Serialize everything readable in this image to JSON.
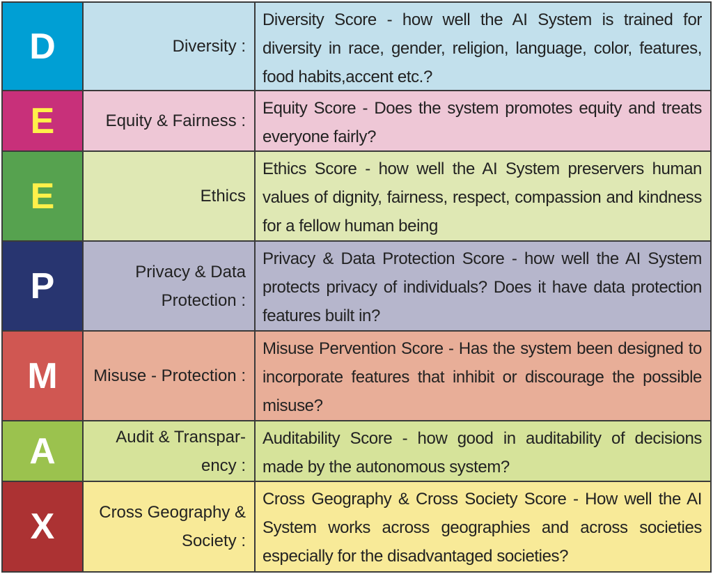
{
  "rows": [
    {
      "letter": "D",
      "label": "Diversity :",
      "description": "Diversity Score - how well the AI System is  trained for diversity in race, gender, religion, language, color, features, food habits,accent etc.?",
      "letter_color": "#ffffff",
      "letter_bg": "#009fd4",
      "row_bg": "#c2e0ec"
    },
    {
      "letter": "E",
      "label": "Equity & Fairness :",
      "description": "Equity Score - Does the system promotes equity and treats everyone fairly?",
      "letter_color": "#fff04a",
      "letter_bg": "#c8307a",
      "row_bg": "#eec7d6"
    },
    {
      "letter": "E",
      "label": "Ethics",
      "description": "Ethics Score - how well the AI System preservers human values of dignity, fairness, respect, compassion and kindness for a fellow human being",
      "letter_color": "#fff04a",
      "letter_bg": "#56a24f",
      "row_bg": "#dfe8b4"
    },
    {
      "letter": "P",
      "label": "Privacy &  Data Protection :",
      "description": "Privacy & Data Protection Score - how well the AI System protects privacy of individuals? Does it have data protection features built in?",
      "letter_color": "#ffffff",
      "letter_bg": "#283570",
      "row_bg": "#b6b6cc"
    },
    {
      "letter": "M",
      "label": "Misuse - Protection :",
      "description": "Misuse Pervention Score - Has the system been designed to incorporate features that inhibit or discourage the possible misuse?",
      "letter_color": "#ffffff",
      "letter_bg": "#d05752",
      "row_bg": "#e8ae98"
    },
    {
      "letter": "A",
      "label": "Audit & Transpar- ency :",
      "description": "Auditability Score - how good in auditability of decisions made by the autonomous system?",
      "letter_color": "#ffffff",
      "letter_bg": "#9bc24e",
      "row_bg": "#d6e39a"
    },
    {
      "letter": "X",
      "label": "Cross Geography & Society :",
      "description": " Cross Geography & Cross Society Score - How well the AI System works across geographies and across societies especially for the disadvantaged  societies?",
      "letter_color": "#ffffff",
      "letter_bg": "#ac3233",
      "row_bg": "#f8ea98"
    }
  ]
}
